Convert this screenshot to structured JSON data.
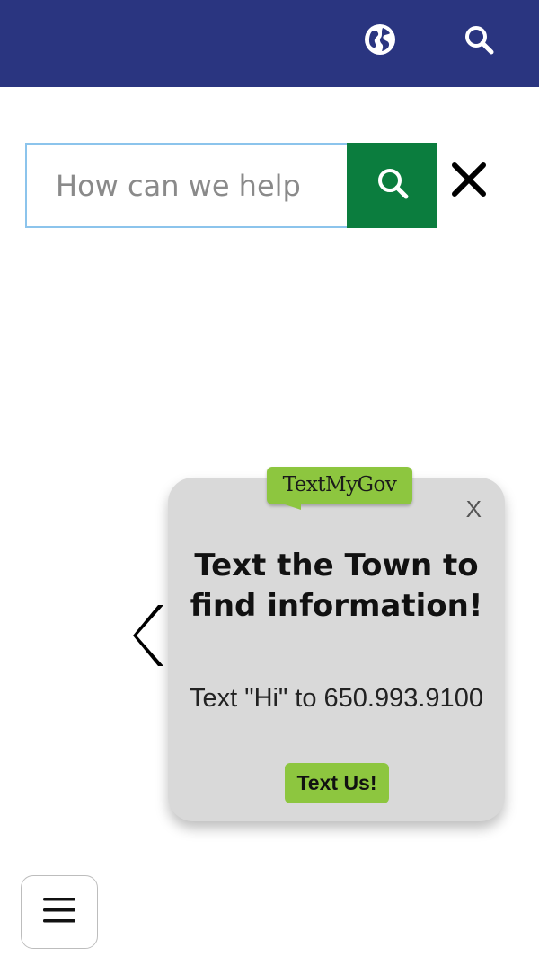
{
  "header": {
    "background_color": "#2a3580",
    "icons": [
      "globe-icon",
      "search-icon"
    ]
  },
  "search": {
    "placeholder": "How can we help",
    "value": "",
    "submit_icon": "search-icon",
    "submit_color": "#0b7d3e",
    "close_icon": "close-icon"
  },
  "carousel": {
    "prev_icon": "chevron-left-icon"
  },
  "popup": {
    "brand": "TextMyGov",
    "brand_color": "#8dc63f",
    "close_label": "X",
    "heading": "Text the Town to find information!",
    "instruction": "Text \"Hi\" to 650.993.9100",
    "cta_label": "Text Us!"
  },
  "menu": {
    "icon": "hamburger-menu-icon"
  }
}
